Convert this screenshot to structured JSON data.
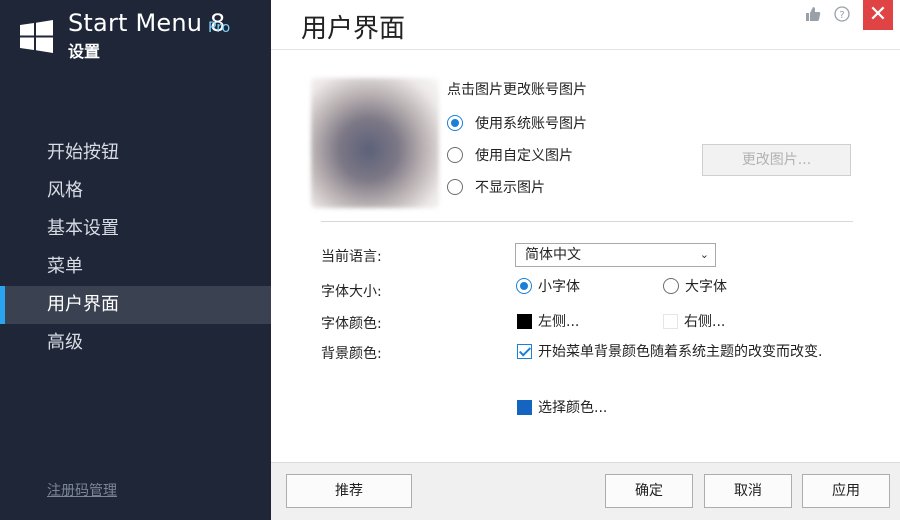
{
  "sidebar": {
    "app_name": "Start Menu 8",
    "edition": "Pro",
    "subtitle": "设置",
    "items": [
      {
        "label": "开始按钮"
      },
      {
        "label": "风格"
      },
      {
        "label": "基本设置"
      },
      {
        "label": "菜单"
      },
      {
        "label": "用户界面"
      },
      {
        "label": "高级"
      }
    ],
    "active_index": 4,
    "register_label": "注册码管理"
  },
  "header": {
    "title": "用户界面",
    "icons": [
      "thumbs-up-icon",
      "help-icon",
      "close-icon"
    ]
  },
  "picture": {
    "hint": "点击图片更改账号图片",
    "options": [
      {
        "label": "使用系统账号图片",
        "selected": true
      },
      {
        "label": "使用自定义图片",
        "selected": false
      },
      {
        "label": "不显示图片",
        "selected": false
      }
    ],
    "change_button": "更改图片..."
  },
  "settings": {
    "language_label": "当前语言:",
    "language_value": "简体中文",
    "font_size_label": "字体大小:",
    "font_size_options": [
      {
        "label": "小字体",
        "selected": true
      },
      {
        "label": "大字体",
        "selected": false
      }
    ],
    "font_color_label": "字体颜色:",
    "left_color_label": "左侧...",
    "left_color": "#000000",
    "right_color_label": "右侧...",
    "right_color": "#ffffff",
    "bg_color_label": "背景颜色:",
    "follow_theme_label": "开始菜单背景颜色随着系统主题的改变而改变.",
    "follow_theme_checked": true,
    "choose_color_label": "选择颜色...",
    "choose_color": "#1565c0"
  },
  "footer": {
    "recommend": "推荐",
    "ok": "确定",
    "cancel": "取消",
    "apply": "应用"
  },
  "colors": {
    "sidebar_bg": "#1e2637",
    "active_item_bg": "#3a4150",
    "accent": "#2aa3f0",
    "close_red": "#e04343"
  }
}
